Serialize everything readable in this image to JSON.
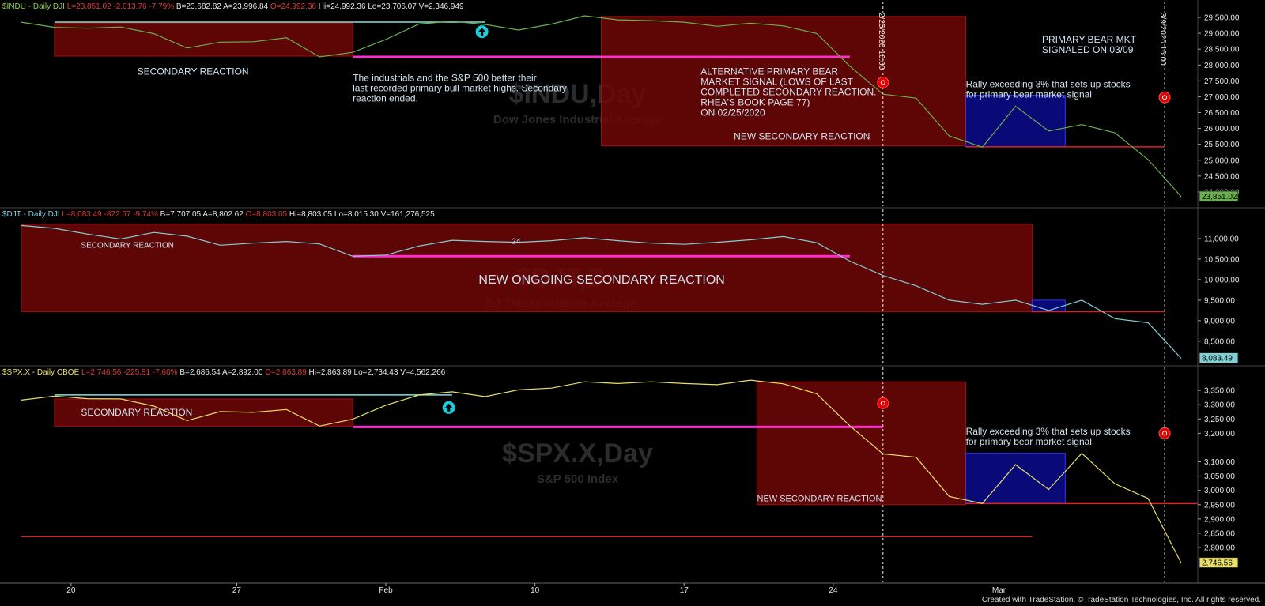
{
  "chart_data": [
    {
      "type": "line",
      "symbol_info": "$INDU - Daily  DJI",
      "readout": {
        "last": "L=23,851.02",
        "change": "-2,013.76",
        "pct": "-7.79%",
        "bid": "B=23,682.82",
        "ask": "A=23,996.84",
        "open": "O=24,992.36",
        "high": "Hi=24,992.36",
        "low": "Lo=23,706.07",
        "volume": "V=2,346,949"
      },
      "watermark": "$INDU,Day",
      "watermark_sub": "Dow Jones Industrial Average",
      "series_color": "#6ab04c",
      "ylim": [
        23500,
        29700
      ],
      "yticks": [
        "29,500.00",
        "29,000.00",
        "28,500.00",
        "28,000.00",
        "27,500.00",
        "27,000.00",
        "26,500.00",
        "26,000.00",
        "25,500.00",
        "25,000.00",
        "24,500.00",
        "24,000.00"
      ],
      "last_label": "23,851.02",
      "last_value": 23851,
      "values": [
        29348,
        29186,
        29160,
        29196,
        28989,
        28535,
        28722,
        28734,
        28859,
        28256,
        28399,
        28807,
        29291,
        29379,
        29276,
        29102,
        29290,
        29551,
        29423,
        29398,
        29348,
        29219,
        29318,
        29232,
        28992,
        27961,
        27081,
        26957,
        25767,
        25409,
        26703,
        25917,
        26121,
        25865,
        25018,
        23851
      ],
      "rects": [
        {
          "x0": 1,
          "x1": 10,
          "y0": 28280,
          "y1": 29320,
          "fill": "#6e0606"
        },
        {
          "x0": 17.5,
          "x1": 28.5,
          "y0": 25450,
          "y1": 29530,
          "fill": "#6e0606"
        },
        {
          "x0": 28.5,
          "x1": 31.5,
          "y0": 25420,
          "y1": 27050,
          "fill": "#0a0a8c"
        }
      ],
      "hlines": [
        {
          "x0": 1,
          "x1": 14,
          "y": 29350,
          "color": "#7fe0e0",
          "w": 1.5
        },
        {
          "x0": 10,
          "x1": 25,
          "y": 28256,
          "color": "#ff2ad4",
          "w": 3
        },
        {
          "x0": 28.5,
          "x1": 34.5,
          "y": 25420,
          "color": "#e02020",
          "w": 1.5
        }
      ],
      "arrow_up": {
        "x": 13.9,
        "y": 29050
      },
      "markers": [
        {
          "x": 26,
          "y": 27450
        },
        {
          "x": 34.5,
          "y": 26980
        }
      ],
      "annotations": [
        {
          "text": "SECONDARY REACTION",
          "x": 3.5,
          "y": 27700
        },
        {
          "lines": [
            "The industrials and the S&P 500 better their",
            "last recorded primary bull market highs. Secondary",
            "reaction ended."
          ],
          "x": 10,
          "y": 27500
        },
        {
          "lines": [
            "ALTERNATIVE PRIMARY BEAR",
            "MARKET SIGNAL (LOWS OF LAST",
            "COMPLETED SECONDARY REACTION.",
            "RHEA'S BOOK PAGE 77)",
            "ON 02/25/2020"
          ],
          "x": 20.5,
          "y": 27700
        },
        {
          "text": "NEW  SECONDARY REACTION",
          "x": 21.5,
          "y": 25650
        },
        {
          "lines": [
            "PRIMARY BEAR MKT",
            "SIGNALED ON 03/09"
          ],
          "x": 30.8,
          "y": 28700
        },
        {
          "lines": [
            "Rally exceeding 3% that sets up stocks",
            "for primary bear market signal"
          ],
          "x": 28.5,
          "y": 27300
        }
      ],
      "vlabels": [
        {
          "text": "2/25/2020 16:00",
          "x": 26
        },
        {
          "text": "3/9/2020 16:00",
          "x": 34.5
        }
      ]
    },
    {
      "type": "line",
      "symbol_info": "$DJT - Daily  DJI",
      "readout": {
        "last": "L=8,083.49",
        "change": "-872.57",
        "pct": "-9.74%",
        "bid": "B=7,707.05",
        "ask": "A=8,802.62",
        "open": "O=8,803.05",
        "high": "Hi=8,803.05",
        "low": "Lo=8,015.30",
        "volume": "V=161,276,525"
      },
      "watermark": "$DJT,D",
      "watermark_sub": "DJ Transportation Average",
      "series_color": "#7fd1d6",
      "ylim": [
        7900,
        11500
      ],
      "yticks": [
        "11,000.00",
        "10,500.00",
        "10,000.00",
        "9,500.00",
        "9,000.00",
        "8,500.00"
      ],
      "last_label": "8,083.49",
      "last_value": 8083,
      "values": [
        11320,
        11250,
        11110,
        10990,
        11150,
        11060,
        10840,
        10890,
        10930,
        10870,
        10570,
        10600,
        10820,
        10960,
        10930,
        10910,
        10950,
        11020,
        10950,
        10890,
        10860,
        10910,
        10970,
        11050,
        10900,
        10450,
        10100,
        9850,
        9500,
        9400,
        9500,
        9250,
        9500,
        9050,
        8950,
        8083
      ],
      "rects": [
        {
          "x0": 0,
          "x1": 30.5,
          "y0": 9220,
          "y1": 11350,
          "fill": "#6e0606"
        },
        {
          "x0": 30.5,
          "x1": 31.5,
          "y0": 9220,
          "y1": 9500,
          "fill": "#0a0a8c"
        }
      ],
      "hlines": [
        {
          "x0": 10,
          "x1": 25,
          "y": 10570,
          "color": "#ff2ad4",
          "w": 3
        },
        {
          "x0": 30.5,
          "x1": 34.5,
          "y": 9220,
          "color": "#e02020",
          "w": 1.5
        }
      ],
      "annotations": [
        {
          "text": "SECONDARY REACTION",
          "x": 1.8,
          "y": 10780,
          "size": 10
        },
        {
          "text": "24",
          "x": 14.8,
          "y": 10870,
          "size": 10
        },
        {
          "text": "NEW ONGOING SECONDARY REACTION",
          "x": 13.8,
          "y": 9900,
          "size": 16
        }
      ]
    },
    {
      "type": "line",
      "symbol_info": "$SPX.X - Daily  CBOE",
      "readout": {
        "last": "L=2,746.56",
        "change": "-225.81",
        "pct": "-7.60%",
        "bid": "B=2,686.54",
        "ask": "A=2,892.00",
        "open": "O=2,863.89",
        "high": "Hi=2,863.89",
        "low": "Lo=2,734.43",
        "volume": "V=4,562,266"
      },
      "watermark": "$SPX.X,Day",
      "watermark_sub": "S&P 500 Index",
      "series_color": "#e8e06a",
      "ylim": [
        2720,
        3400
      ],
      "yticks": [
        "3,350.00",
        "3,300.00",
        "3,250.00",
        "3,200.00",
        "3,100.00",
        "3,050.00",
        "3,000.00",
        "2,950.00",
        "2,900.00",
        "2,850.00",
        "2,800.00"
      ],
      "last_label": "2,746.56",
      "last_value": 2746,
      "values": [
        3316,
        3330,
        3321,
        3320,
        3295,
        3244,
        3276,
        3273,
        3283,
        3225,
        3249,
        3298,
        3334,
        3345,
        3328,
        3352,
        3358,
        3380,
        3374,
        3380,
        3374,
        3370,
        3386,
        3373,
        3338,
        3226,
        3128,
        3116,
        2979,
        2954,
        3090,
        3003,
        3130,
        3023,
        2972,
        2746
      ],
      "rects": [
        {
          "x0": 1,
          "x1": 10,
          "y0": 3225,
          "y1": 3320,
          "fill": "#6e0606"
        },
        {
          "x0": 22.2,
          "x1": 28.5,
          "y0": 2950,
          "y1": 3380,
          "fill": "#6e0606"
        },
        {
          "x0": 28.5,
          "x1": 31.5,
          "y0": 2954,
          "y1": 3130,
          "fill": "#0a0a8c"
        }
      ],
      "hlines": [
        {
          "x0": 1,
          "x1": 13,
          "y": 3334,
          "color": "#7fe0e0",
          "w": 1.5
        },
        {
          "x0": 10,
          "x1": 26,
          "y": 3222,
          "color": "#ff2ad4",
          "w": 3
        },
        {
          "x0": 28.5,
          "x1": 35.5,
          "y": 2954,
          "color": "#e02020",
          "w": 1.5
        },
        {
          "x0": 0,
          "x1": 30.5,
          "y": 2838,
          "color": "#e02020",
          "w": 1.5
        }
      ],
      "arrow_up": {
        "x": 12.9,
        "y": 3290
      },
      "markers": [
        {
          "x": 26,
          "y": 3305
        },
        {
          "x": 34.5,
          "y": 3200
        }
      ],
      "annotations": [
        {
          "text": "SECONDARY REACTION",
          "x": 1.8,
          "y": 3262
        },
        {
          "text": "NEW SECONDARY REACTION",
          "x": 22.2,
          "y": 2962,
          "size": 11
        },
        {
          "lines": [
            "Rally exceeding 3% that sets up stocks",
            "for primary bear market signal"
          ],
          "x": 28.5,
          "y": 3195
        }
      ]
    }
  ],
  "x_axis": {
    "labels": [
      {
        "text": "20",
        "x": 1.5
      },
      {
        "text": "27",
        "x": 6.5
      },
      {
        "text": "Feb",
        "x": 11
      },
      {
        "text": "10",
        "x": 15.5
      },
      {
        "text": "17",
        "x": 20
      },
      {
        "text": "24",
        "x": 24.5
      },
      {
        "text": "Mar",
        "x": 29.5
      }
    ]
  },
  "footer": "Created with TradeStation. ©TradeStation Technologies, Inc. All rights reserved."
}
